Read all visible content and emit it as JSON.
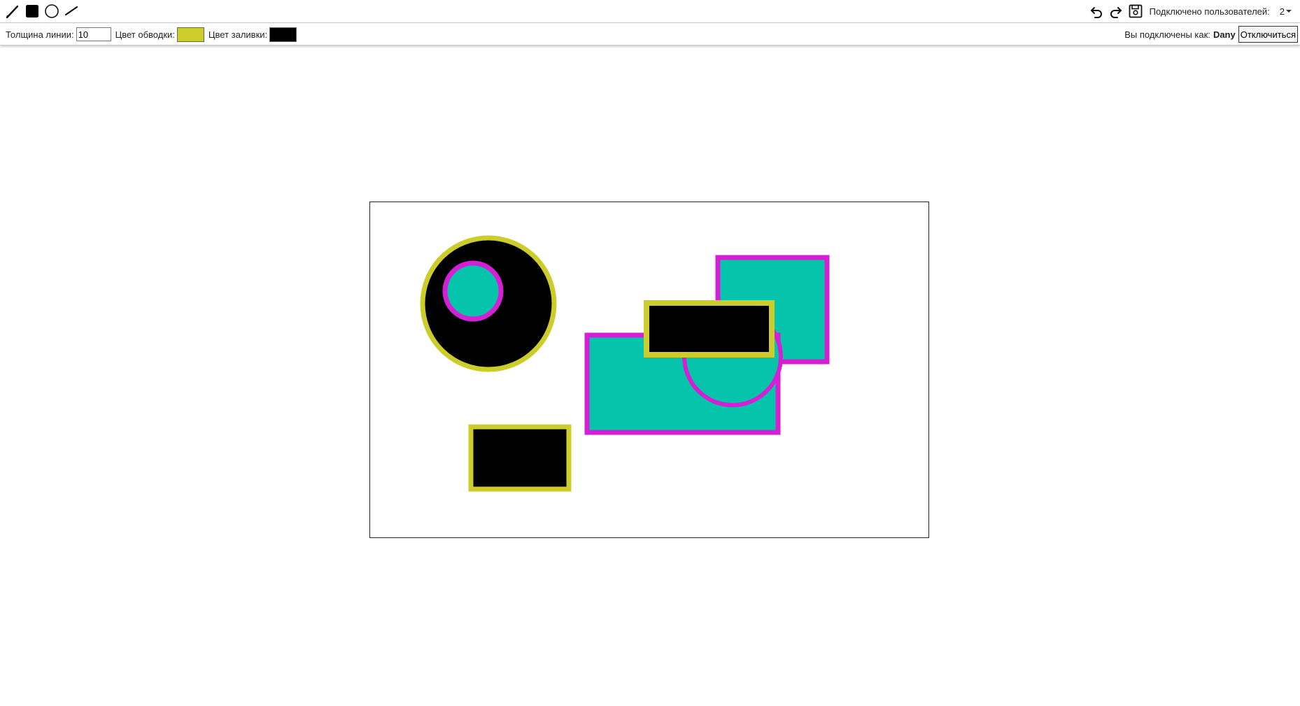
{
  "toolbar": {
    "tools": [
      {
        "name": "pencil",
        "icon": "pencil-icon"
      },
      {
        "name": "rectangle",
        "icon": "filled-square-icon"
      },
      {
        "name": "circle",
        "icon": "circle-icon"
      },
      {
        "name": "line",
        "icon": "line-icon"
      }
    ],
    "actions": [
      "undo-icon",
      "redo-icon",
      "save-icon"
    ],
    "users_label": "Подключено пользователей:",
    "users_count": "2"
  },
  "options": {
    "thickness_label": "Толщина линии:",
    "thickness_value": "10",
    "stroke_label": "Цвет обводки:",
    "stroke_color": "#cccc2a",
    "fill_label": "Цвет заливки:",
    "fill_color": "#000000",
    "connected_as_label": "Вы подключены как:",
    "username": "Dany",
    "disconnect_label": "Отключиться"
  },
  "canvas": {
    "colors": {
      "yellow": "#cccc2a",
      "magenta": "#d41fd4",
      "teal": "#05c4ab",
      "black": "#000000"
    }
  }
}
